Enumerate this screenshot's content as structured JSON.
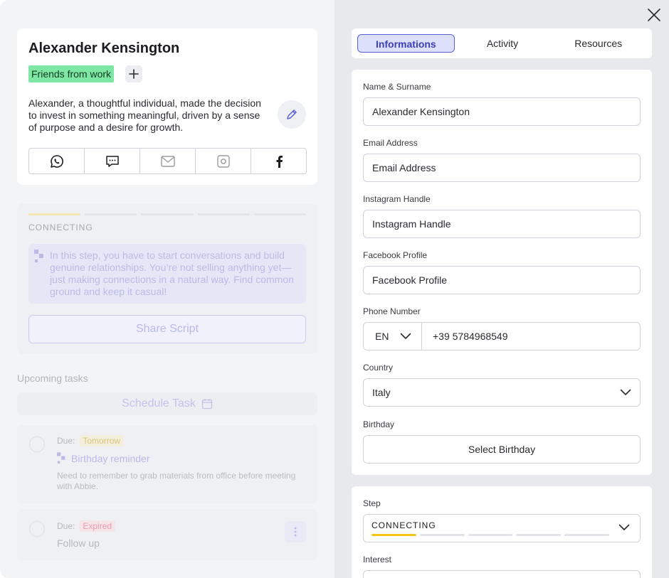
{
  "contact": {
    "name": "Alexander Kensington",
    "tag": "Friends from work",
    "bio": "Alexander, a thoughtful individual, made the decision to invest in something meaningful, driven by a sense of purpose and a desire for growth.",
    "socials": [
      "whatsapp-icon",
      "message-icon",
      "mail-icon",
      "instagram-icon",
      "facebook-icon"
    ]
  },
  "step_panel": {
    "label": "CONNECTING",
    "progress_active_segments": 1,
    "progress_total_segments": 5,
    "info": "In this step, you have to start conversations and build genuine relationships. You’re not selling anything yet—just making connections in a natural way. Find common ground and keep it casual!",
    "share_label": "Share Script"
  },
  "tasks": {
    "title": "Upcoming tasks",
    "schedule_label": "Schedule Task",
    "items": [
      {
        "due_label": "Due:",
        "due": "Tomorrow",
        "title": "Birthday reminder",
        "description": "Need to remember to grab materials from office before meeting with Abbie."
      },
      {
        "due_label": "Due:",
        "due": "Expired",
        "title": "Follow up"
      }
    ]
  },
  "tabs": [
    "Informations",
    "Activity",
    "Resources"
  ],
  "form": {
    "name_label": "Name & Surname",
    "name_value": "Alexander Kensington",
    "email_label": "Email Address",
    "email_placeholder": "Email Address",
    "instagram_label": "Instagram Handle",
    "instagram_placeholder": "Instagram Handle",
    "facebook_label": "Facebook Profile",
    "facebook_placeholder": "Facebook Profile",
    "phone_label": "Phone Number",
    "phone_code": "EN",
    "phone_value": "+39 5784968549",
    "country_label": "Country",
    "country_value": "Italy",
    "birthday_label": "Birthday",
    "birthday_button": "Select Birthday",
    "step_label": "Step",
    "step_value": "CONNECTING",
    "interest_label": "Interest"
  },
  "colors": {
    "accent": "#5b5fd6",
    "tag_green": "#7ee7a3",
    "step_yellow": "#f5c518"
  }
}
